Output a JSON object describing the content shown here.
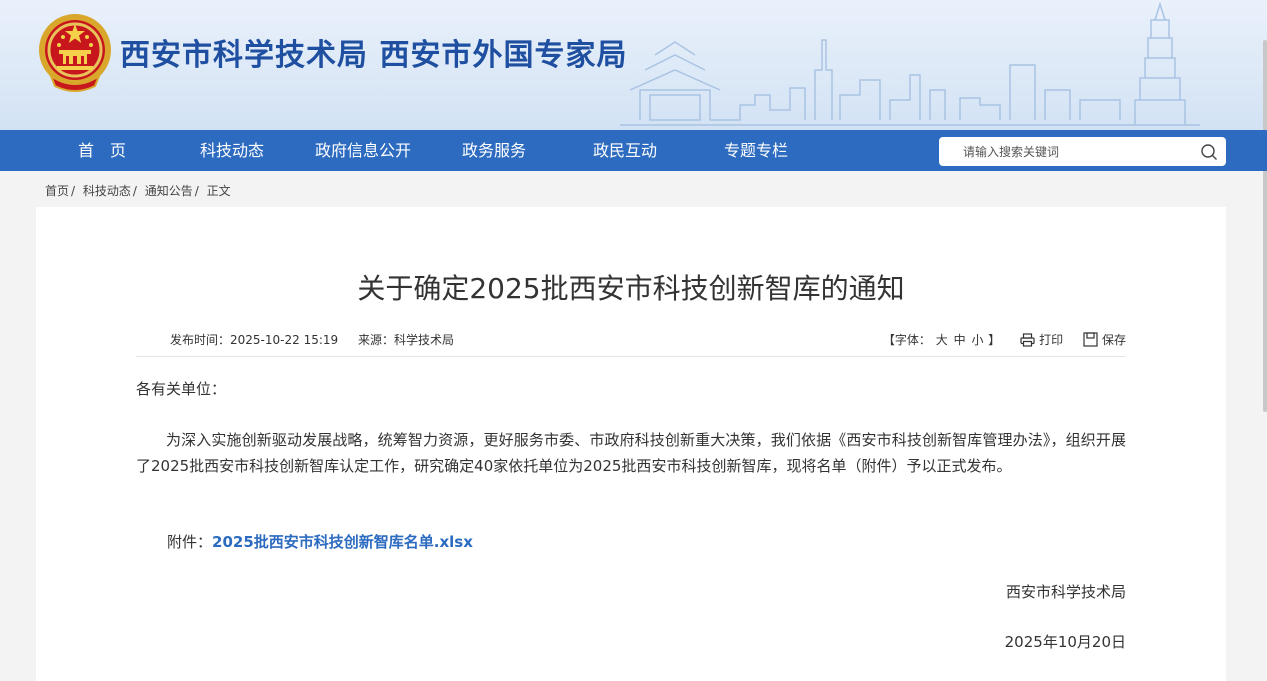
{
  "header": {
    "site_title": "西安市科学技术局 西安市外国专家局",
    "emblem_icon": "national-emblem-icon",
    "colors": {
      "title": "#1f4fa0",
      "navbar": "#2c6bbf"
    }
  },
  "nav": {
    "items": [
      {
        "label": "首　页"
      },
      {
        "label": "科技动态"
      },
      {
        "label": "政府信息公开"
      },
      {
        "label": "政务服务"
      },
      {
        "label": "政民互动"
      },
      {
        "label": "专题专栏"
      }
    ]
  },
  "search": {
    "placeholder": "请输入搜索关键词",
    "icon": "search-icon"
  },
  "breadcrumb": {
    "items": [
      "首页",
      "科技动态",
      "通知公告",
      "正文"
    ]
  },
  "article": {
    "title": "关于确定2025批西安市科技创新智库的通知",
    "publish_label": "发布时间：",
    "publish_time": "2025-10-22 15:19",
    "source_label": "来源：",
    "source": "科学技术局",
    "font_size_prefix": "【字体：",
    "font_sizes": [
      "大",
      "中",
      "小"
    ],
    "font_size_suffix": "】",
    "print_label": "打印",
    "save_label": "保存",
    "salutation": "各有关单位：",
    "body": "为深入实施创新驱动发展战略，统筹智力资源，更好服务市委、市政府科技创新重大决策，我们依据《西安市科技创新智库管理办法》，组织开展了2025批西安市科技创新智库认定工作，研究确定40家依托单位为2025批西安市科技创新智库，现将名单（附件）予以正式发布。",
    "attachment_label": "附件：",
    "attachment_link": "2025批西安市科技创新智库名单.xlsx",
    "signature": "西安市科学技术局",
    "date": "2025年10月20日"
  }
}
